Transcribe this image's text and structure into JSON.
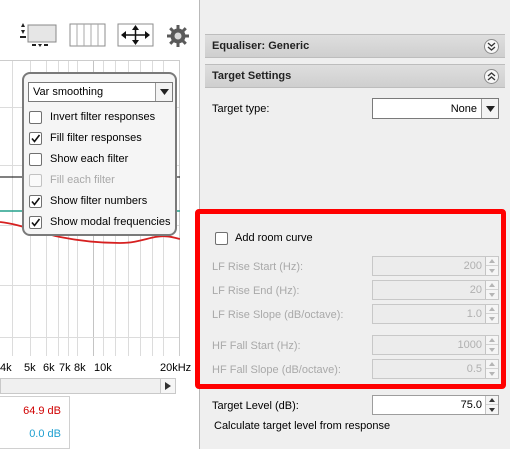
{
  "toolbar": {
    "icons": [
      "graph-layout-icon",
      "columns-icon",
      "fit-arrows-icon",
      "gear-icon"
    ]
  },
  "graph": {
    "x_ticks": [
      "4k",
      "5k",
      "6k",
      "7k",
      "8k",
      "10k",
      "20kHz"
    ],
    "readouts": [
      {
        "value": "64.9 dB",
        "color": "#d00000"
      },
      {
        "value": "0.0 dB",
        "color": "#1e9fd0"
      }
    ],
    "curve_colors": {
      "response": "#d62020",
      "target": "#23a08c",
      "reference": "#000000"
    }
  },
  "graph_options": {
    "smoothing": "Var smoothing",
    "items": [
      {
        "label": "Invert filter responses",
        "checked": false,
        "enabled": true
      },
      {
        "label": "Fill filter responses",
        "checked": true,
        "enabled": true
      },
      {
        "label": "Show each filter",
        "checked": false,
        "enabled": true
      },
      {
        "label": "Fill each filter",
        "checked": false,
        "enabled": false
      },
      {
        "label": "Show filter numbers",
        "checked": true,
        "enabled": true
      },
      {
        "label": "Show modal frequencies",
        "checked": true,
        "enabled": true
      }
    ]
  },
  "equaliser": {
    "title": "Equaliser: Generic"
  },
  "target_settings": {
    "title": "Target Settings",
    "target_type_label": "Target type:",
    "target_type_value": "None",
    "add_room_curve_label": "Add room curve",
    "add_room_curve_checked": false,
    "lf_rise_start_label": "LF Rise Start (Hz):",
    "lf_rise_start_value": "200",
    "lf_rise_end_label": "LF Rise End (Hz):",
    "lf_rise_end_value": "20",
    "lf_rise_slope_label": "LF Rise Slope (dB/octave):",
    "lf_rise_slope_value": "1.0",
    "hf_fall_start_label": "HF Fall Start (Hz):",
    "hf_fall_start_value": "1000",
    "hf_fall_slope_label": "HF Fall Slope (dB/octave):",
    "hf_fall_slope_value": "0.5",
    "target_level_label": "Target Level (dB):",
    "target_level_value": "75.0",
    "calculate_label": "Calculate target level from response"
  },
  "highlight_color": "#ff0000"
}
